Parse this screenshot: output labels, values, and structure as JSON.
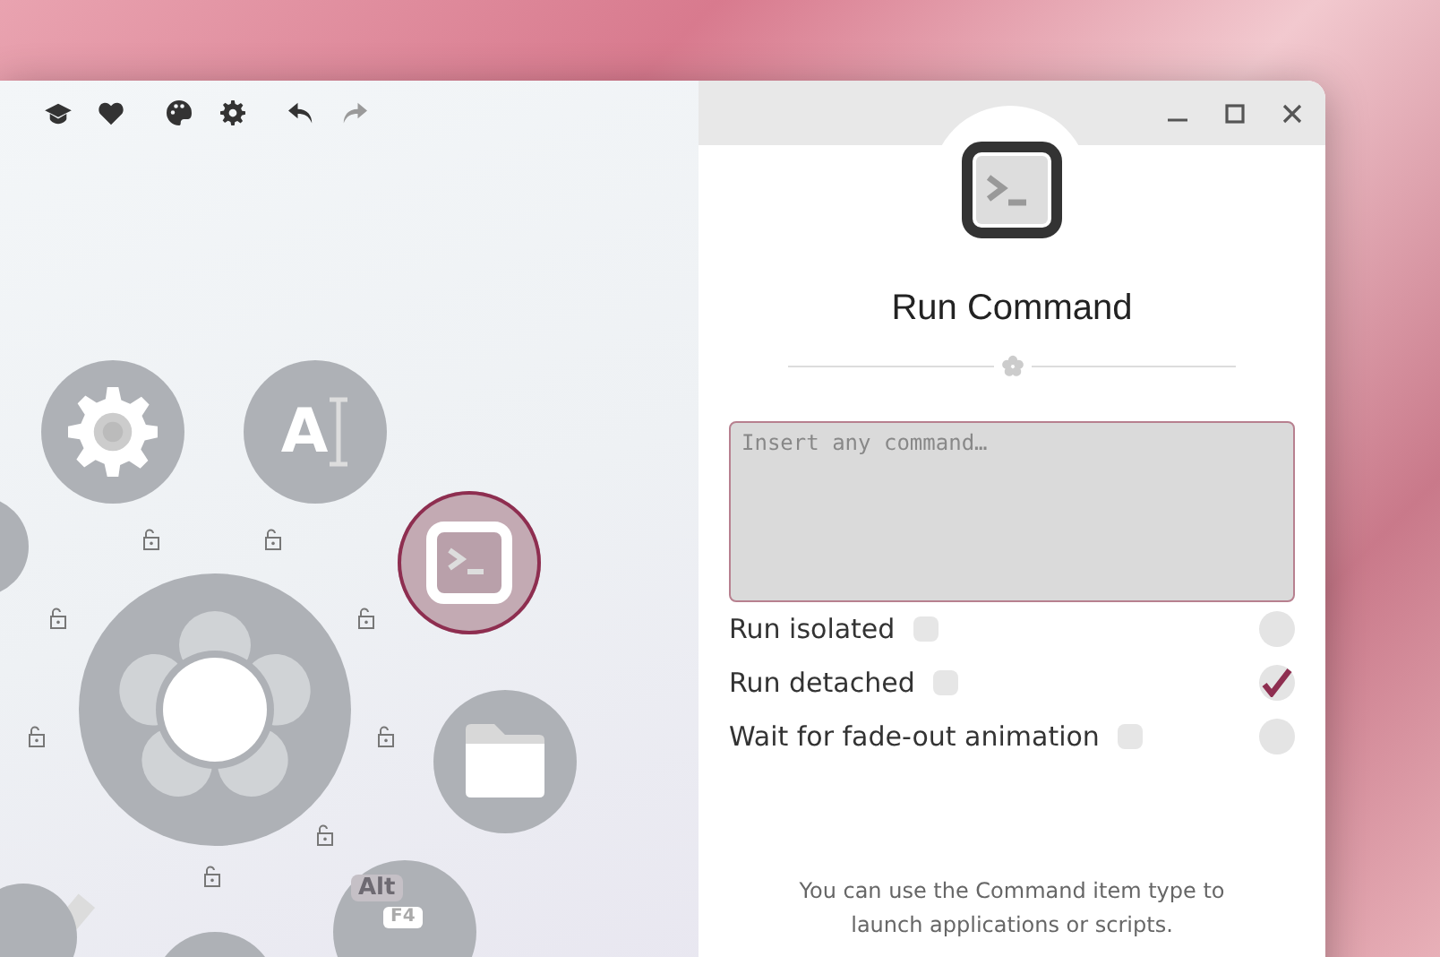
{
  "toolbar": [
    {
      "kind": "cap",
      "disabled": false
    },
    {
      "kind": "heart",
      "disabled": false
    },
    {
      "kind": "palette",
      "disabled": false
    },
    {
      "kind": "gear",
      "disabled": false
    },
    {
      "kind": "undo",
      "disabled": false
    },
    {
      "kind": "redo",
      "disabled": true
    }
  ],
  "menu_items": [
    {
      "kind": "gear",
      "selected": false
    },
    {
      "kind": "text-cursor",
      "label": "A",
      "selected": false
    },
    {
      "kind": "terminal",
      "selected": true
    },
    {
      "kind": "flower",
      "selected": false
    },
    {
      "kind": "folder",
      "selected": false
    },
    {
      "kind": "hotkey",
      "label": "Alt",
      "key": "F4",
      "selected": false
    },
    {
      "kind": "partial",
      "selected": false
    },
    {
      "kind": "partial",
      "selected": false
    },
    {
      "kind": "partial",
      "selected": false
    }
  ],
  "window_controls": [
    {
      "kind": "minimize"
    },
    {
      "kind": "maximize"
    },
    {
      "kind": "close"
    }
  ],
  "dialog": {
    "title": "Run Command",
    "command": {
      "placeholder": "Insert any command…"
    },
    "options": [
      {
        "label": "Run isolated",
        "checked": false
      },
      {
        "label": "Run detached",
        "checked": true
      },
      {
        "label": "Wait for fade-out animation",
        "checked": false
      }
    ],
    "hint": "You can use the Command item type to launch applications or scripts."
  }
}
